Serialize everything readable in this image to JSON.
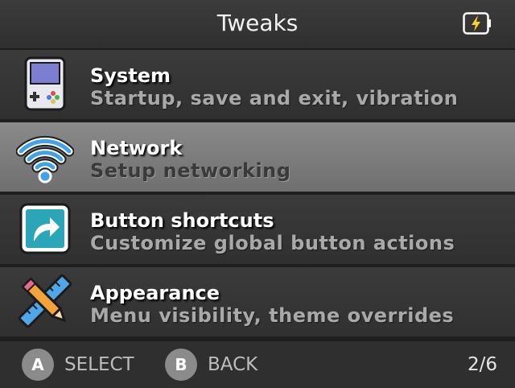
{
  "header": {
    "title": "Tweaks",
    "battery_icon": "battery-charging-icon"
  },
  "menu": {
    "items": [
      {
        "label": "System",
        "sub": "Startup, save and exit, vibration",
        "icon": "handheld-console-icon",
        "selected": false
      },
      {
        "label": "Network",
        "sub": "Setup networking",
        "icon": "wifi-icon",
        "selected": true
      },
      {
        "label": "Button shortcuts",
        "sub": "Customize global button actions",
        "icon": "shortcut-arrow-icon",
        "selected": false
      },
      {
        "label": "Appearance",
        "sub": "Menu visibility, theme overrides",
        "icon": "ruler-pencil-icon",
        "selected": false
      }
    ]
  },
  "footer": {
    "a_button": "A",
    "a_label": "SELECT",
    "b_button": "B",
    "b_label": "BACK",
    "page_indicator": "2/6"
  },
  "colors": {
    "accent_battery": "#ffd21a",
    "wifi_blue": "#3fa3e6",
    "shortcut_teal": "#2aa6b8"
  }
}
